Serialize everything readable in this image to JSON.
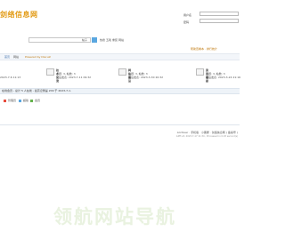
{
  "header": {
    "logo_text": "剑络信息网",
    "username_label": "用户名",
    "password_label": "密码"
  },
  "search": {
    "scope": "帖子",
    "links": [
      "热搜",
      "五笔",
      "重装",
      "网站"
    ]
  },
  "nav": {
    "right_links": "帮助查看本 · 排行统计",
    "breadcrumb": [
      "网站",
      "首页",
      "Powered by Discuz!"
    ]
  },
  "forums": [
    {
      "title": "技术交流",
      "stats": "主题: 3, 帖数: 3",
      "last": "最后发表: 2023-7-11 09:32"
    },
    {
      "title": "网站建设",
      "stats": "主题: 3, 帖数: 3",
      "last": "最后发表: 2023-3-30 20:32"
    },
    {
      "title": "资讯播报",
      "stats": "主题: 3, 帖数: 3",
      "last": "最后发表: 2023-3-24 21:16"
    }
  ],
  "left_times": [
    "2023-7-6 11:13"
  ],
  "online_bar": "在线会员 - 总计 5 人在线 - 最高记录是 209 于 2023-7-1.",
  "legend": [
    {
      "label": "管理员",
      "color": "#e84c3d"
    },
    {
      "label": "超版",
      "color": "#5aa7e0"
    },
    {
      "label": "会员",
      "color": "#63b24b"
    }
  ],
  "footer": {
    "links": "Archiver · 手机版 · 小黑屋 · 剑络信息网 ( 备案号 )",
    "copyright": "GMT+8, 2023-7-17 11:34 , Processed in 0.03 second(s)"
  },
  "watermark": "领航网站导航"
}
